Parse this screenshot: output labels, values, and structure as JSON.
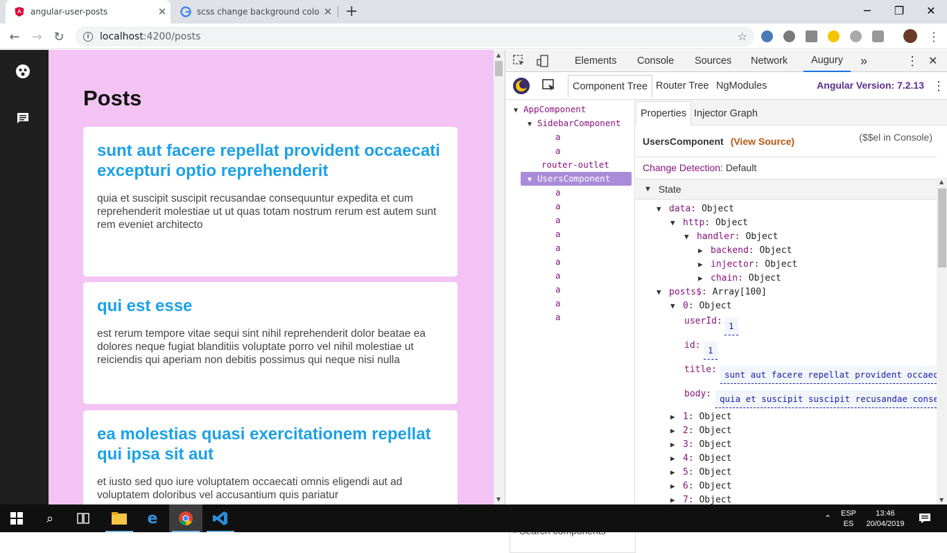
{
  "browser": {
    "tabs": [
      {
        "title": "angular-user-posts"
      },
      {
        "title": "scss change background color of"
      }
    ],
    "url_host": "localhost",
    "url_path": ":4200/posts"
  },
  "page": {
    "heading": "Posts",
    "posts": [
      {
        "title": "sunt aut facere repellat provident occaecati excepturi optio reprehenderit",
        "body": "quia et suscipit suscipit recusandae consequuntur expedita et cum reprehenderit molestiae ut ut quas totam nostrum rerum est autem sunt rem eveniet architecto"
      },
      {
        "title": "qui est esse",
        "body": "est rerum tempore vitae sequi sint nihil reprehenderit dolor beatae ea dolores neque fugiat blanditiis voluptate porro vel nihil molestiae ut reiciendis qui aperiam non debitis possimus qui neque nisi nulla"
      },
      {
        "title": "ea molestias quasi exercitationem repellat qui ipsa sit aut",
        "body": "et iusto sed quo iure voluptatem occaecati omnis eligendi aut ad voluptatem doloribus vel accusantium quis pariatur"
      }
    ]
  },
  "devtools": {
    "tabs": [
      "Elements",
      "Console",
      "Sources",
      "Network",
      "Augury"
    ],
    "more": "»",
    "augury": {
      "tabs": [
        "Component Tree",
        "Router Tree",
        "NgModules"
      ],
      "angular_version": "Angular Version: 7.2.13",
      "tree": {
        "app": "AppComponent",
        "sidebar": "SidebarComponent",
        "anchor": "a",
        "outlet": "router-outlet",
        "users": "UsersComponent"
      },
      "search_placeholder": "Search components",
      "props_tabs": [
        "Properties",
        "Injector Graph"
      ],
      "component_name": "UsersComponent",
      "view_source": "(View Source)",
      "sel_console": "($$el in Console)",
      "change_detection_label": "Change Detection:",
      "change_detection_value": "Default",
      "state_label": "State",
      "props": {
        "data": "data:",
        "data_t": "Object",
        "http": "http:",
        "http_t": "Object",
        "handler": "handler:",
        "handler_t": "Object",
        "backend": "backend:",
        "backend_t": "Object",
        "injector": "injector:",
        "injector_t": "Object",
        "chain": "chain:",
        "chain_t": "Object",
        "posts": "posts$:",
        "posts_t": "Array[100]",
        "p0": "0:",
        "p0_t": "Object",
        "userId": "userId:",
        "userId_v": "1",
        "id": "id:",
        "id_v": "1",
        "title": "title:",
        "title_v": "sunt aut facere repellat provident occaecati excepturi optio reprehenderit",
        "body": "body:",
        "body_v": "quia et suscipit suscipit recusandae consequuntur expedita et cum reprehenderit",
        "p1": "1:",
        "p2": "2:",
        "p3": "3:",
        "p4": "4:",
        "p5": "5:",
        "p6": "6:",
        "p7": "7:",
        "obj": "Object"
      }
    }
  },
  "taskbar": {
    "lang1": "ESP",
    "lang2": "ES",
    "time": "13:46",
    "date": "20/04/2019"
  },
  "colors": {
    "page_bg": "#f3c4f3",
    "post_title": "#1da1e6",
    "sidebar": "#1f1f1f",
    "augury_accent": "#5c2d91"
  }
}
